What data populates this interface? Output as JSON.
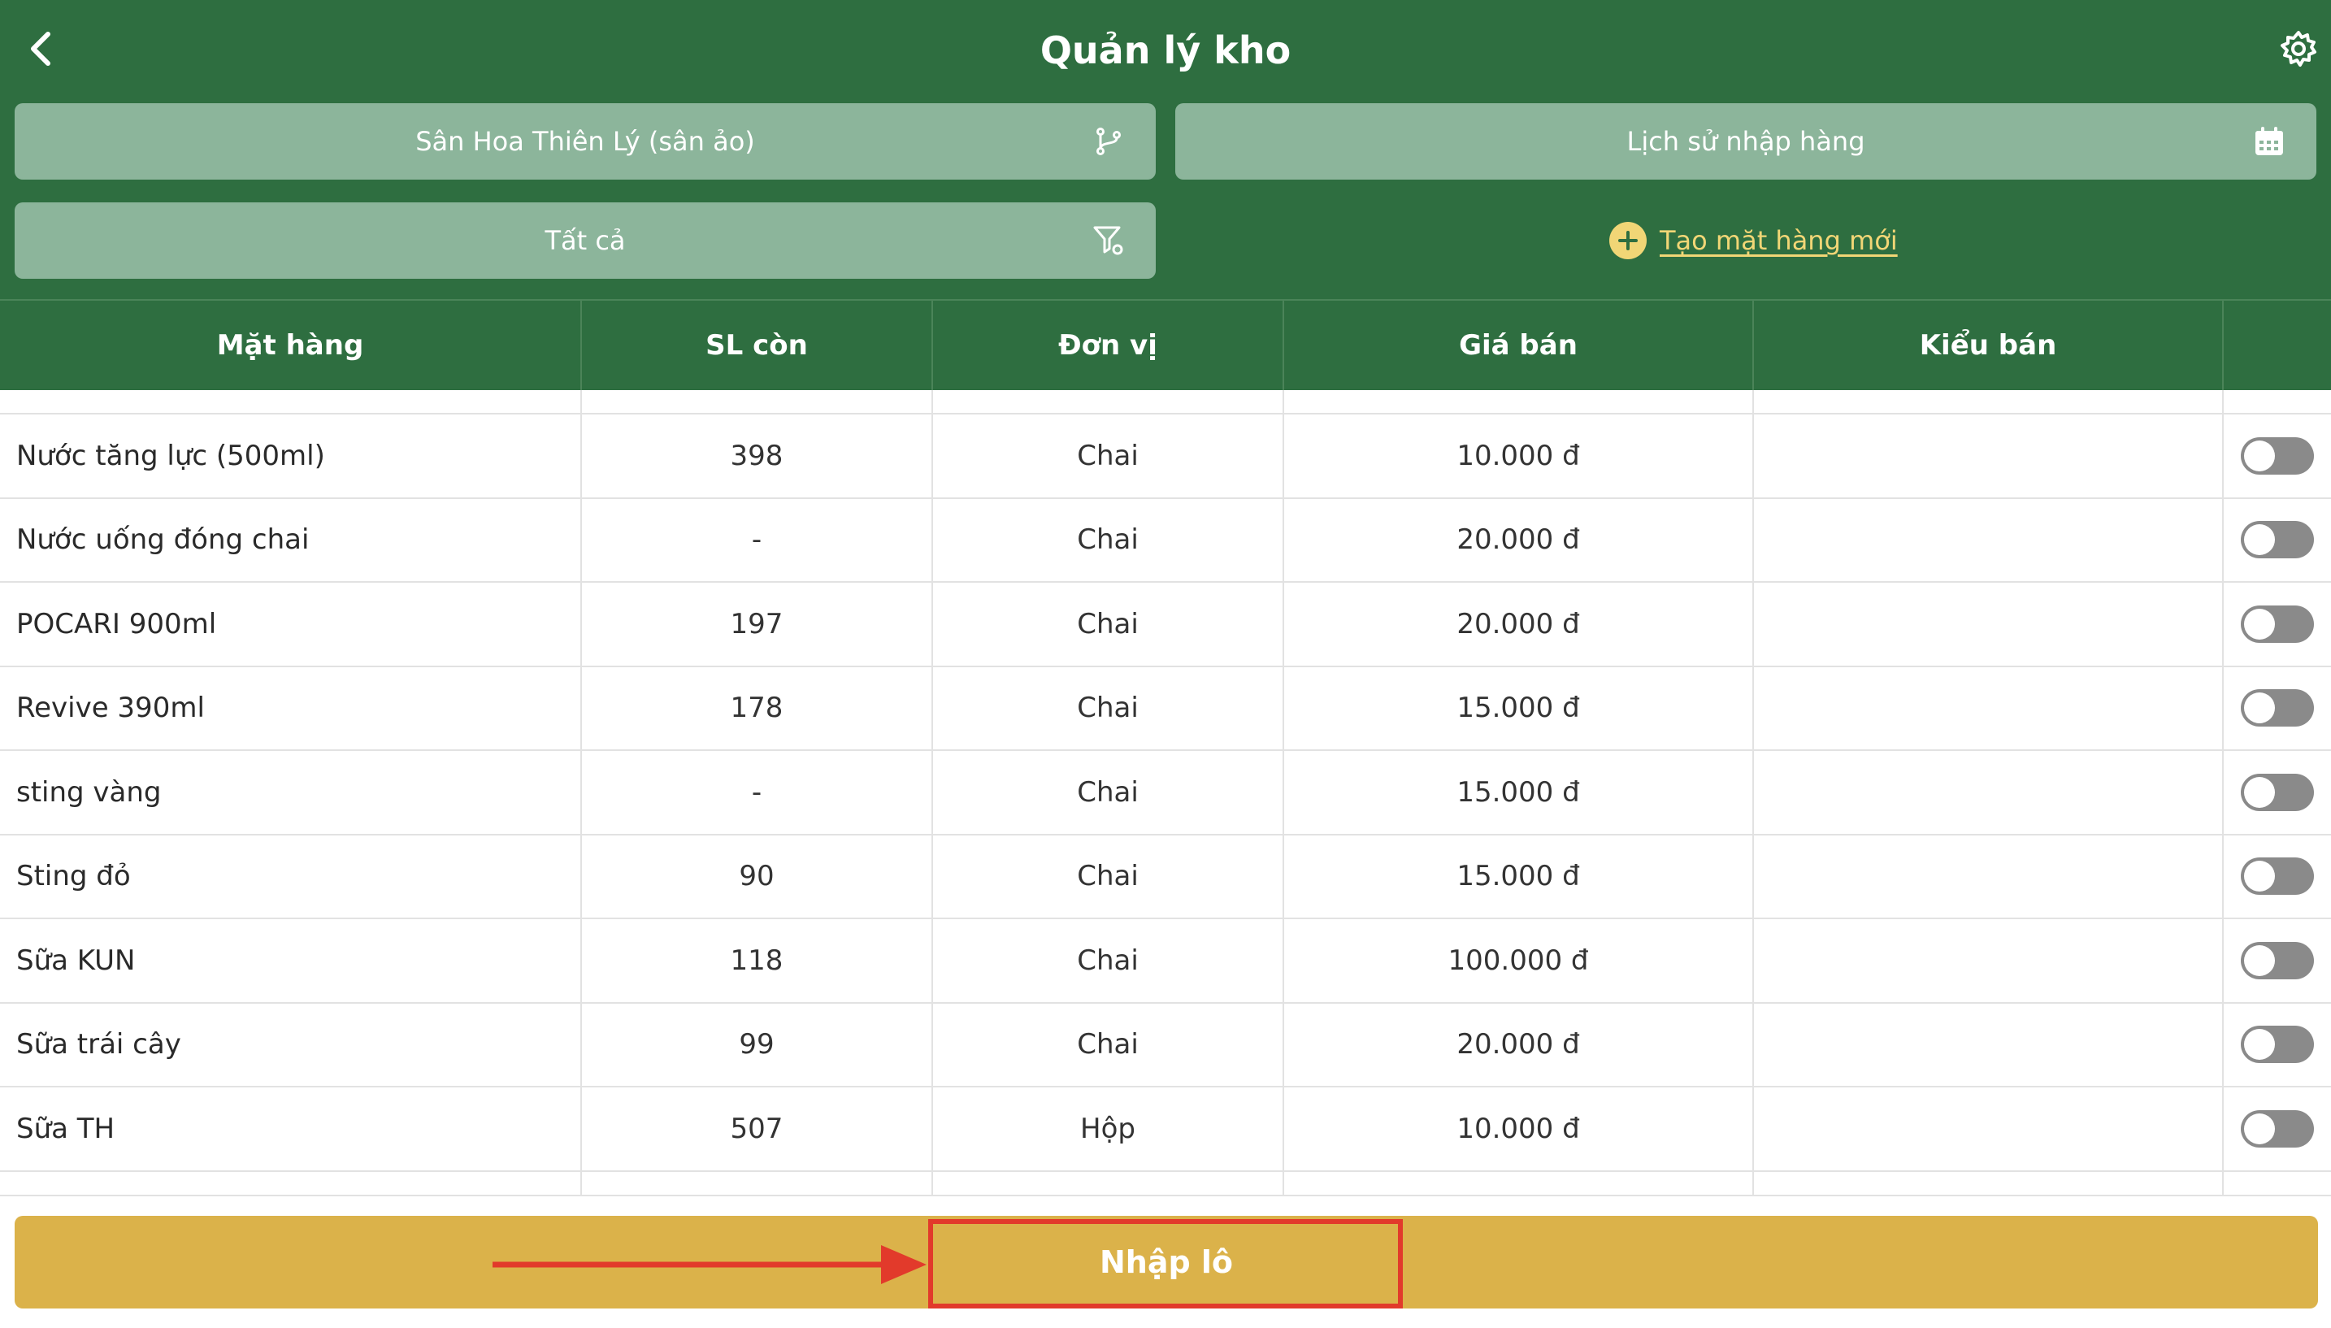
{
  "header": {
    "title": "Quản lý kho",
    "back_icon": "chevron-left-icon",
    "settings_icon": "gear-icon"
  },
  "filters": {
    "venue": {
      "label": "Sân Hoa Thiên Lý (sân ảo)",
      "icon": "branch-icon"
    },
    "history": {
      "label": "Lịch sử nhập hàng",
      "icon": "calendar-icon"
    },
    "category": {
      "label": "Tất cả",
      "icon": "filter-settings-icon"
    },
    "create_new": {
      "label": "Tạo mặt hàng mới",
      "icon": "plus-circle-icon"
    }
  },
  "table": {
    "columns": [
      "Mặt hàng",
      "SL còn",
      "Đơn vị",
      "Giá bán",
      "Kiểu bán",
      ""
    ],
    "rows": [
      {
        "name": "Nước tăng lực (500ml)",
        "qty": "398",
        "unit": "Chai",
        "price": "10.000 đ",
        "sale_type": "",
        "enabled": false
      },
      {
        "name": "Nước uống đóng chai",
        "qty": "-",
        "unit": "Chai",
        "price": "20.000 đ",
        "sale_type": "",
        "enabled": false
      },
      {
        "name": "POCARI 900ml",
        "qty": "197",
        "unit": "Chai",
        "price": "20.000 đ",
        "sale_type": "",
        "enabled": false
      },
      {
        "name": "Revive 390ml",
        "qty": "178",
        "unit": "Chai",
        "price": "15.000 đ",
        "sale_type": "",
        "enabled": false
      },
      {
        "name": "sting vàng",
        "qty": "-",
        "unit": "Chai",
        "price": "15.000 đ",
        "sale_type": "",
        "enabled": false
      },
      {
        "name": "Sting đỏ",
        "qty": "90",
        "unit": "Chai",
        "price": "15.000 đ",
        "sale_type": "",
        "enabled": false
      },
      {
        "name": "Sữa KUN",
        "qty": "118",
        "unit": "Chai",
        "price": "100.000 đ",
        "sale_type": "",
        "enabled": false
      },
      {
        "name": "Sữa trái cây",
        "qty": "99",
        "unit": "Chai",
        "price": "20.000 đ",
        "sale_type": "",
        "enabled": false
      },
      {
        "name": "Sữa TH",
        "qty": "507",
        "unit": "Hộp",
        "price": "10.000 đ",
        "sale_type": "",
        "enabled": false
      }
    ]
  },
  "footer": {
    "submit_label": "Nhập lô"
  },
  "colors": {
    "header_bg": "#2e6e40",
    "pill_bg": "#8cb59b",
    "accent_yellow": "#f1d676",
    "submit_bg": "#dbb24a",
    "annotation_red": "#e23a2b",
    "toggle_off": "#8a8a8a"
  }
}
